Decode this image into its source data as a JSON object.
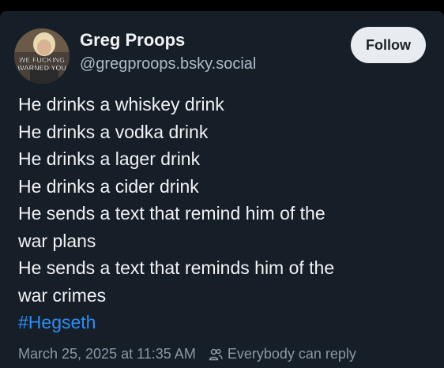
{
  "author": {
    "name": "Greg Proops",
    "handle": "@gregproops.bsky.social",
    "avatar_text_line1": "WE FUCKING",
    "avatar_text_line2": "WARNED YOU"
  },
  "follow_button": {
    "label": "Follow"
  },
  "post": {
    "lines": [
      "He drinks a whiskey drink",
      "He drinks a vodka drink",
      "He drinks a lager drink",
      "He drinks a cider drink",
      "He sends a text that remind him of the",
      "war plans",
      "He sends a text that reminds him of the",
      "war crimes"
    ],
    "hashtag": "#Hegseth"
  },
  "meta": {
    "timestamp": "March 25, 2025 at 11:35 AM",
    "reply_setting": "Everybody can reply"
  },
  "colors": {
    "background": "#161e27",
    "hashtag": "#2c8ef5",
    "follow_button_bg": "#e8ecf0"
  }
}
